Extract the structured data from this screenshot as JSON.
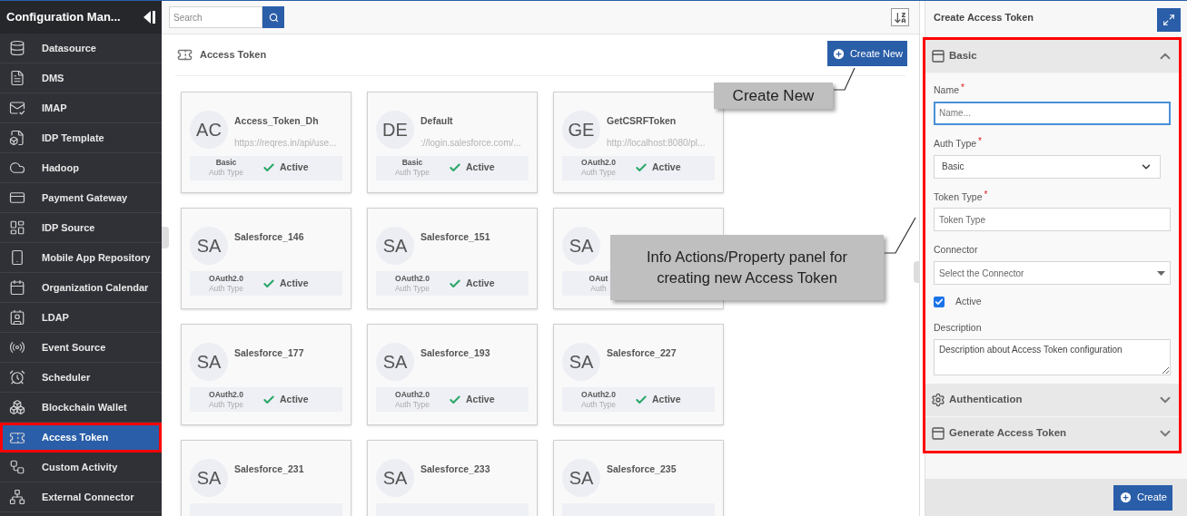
{
  "sidebar": {
    "title": "Configuration Man...",
    "items": [
      {
        "label": "Datasource",
        "selected": false
      },
      {
        "label": "DMS",
        "selected": false
      },
      {
        "label": "IMAP",
        "selected": false
      },
      {
        "label": "IDP Template",
        "selected": false
      },
      {
        "label": "Hadoop",
        "selected": false
      },
      {
        "label": "Payment Gateway",
        "selected": false
      },
      {
        "label": "IDP Source",
        "selected": false
      },
      {
        "label": "Mobile App Repository",
        "selected": false
      },
      {
        "label": "Organization Calendar",
        "selected": false
      },
      {
        "label": "LDAP",
        "selected": false
      },
      {
        "label": "Event Source",
        "selected": false
      },
      {
        "label": "Scheduler",
        "selected": false
      },
      {
        "label": "Blockchain Wallet",
        "selected": false
      },
      {
        "label": "Access Token",
        "selected": true
      },
      {
        "label": "Custom Activity",
        "selected": false
      },
      {
        "label": "External Connector",
        "selected": false
      }
    ]
  },
  "toolbar": {
    "search": {
      "placeholder": "Search"
    }
  },
  "main": {
    "title": "Access Token",
    "create_button": "Create New",
    "cards": [
      {
        "initials": "AC",
        "name": "Access_Token_Dh",
        "url": "https://reqres.in/api/use...",
        "auth_type": "Basic",
        "auth_label": "Auth Type",
        "status": "Active",
        "active": true
      },
      {
        "initials": "DE",
        "name": "Default",
        "url": "://login.salesforce.com/...",
        "auth_type": "Basic",
        "auth_label": "Auth Type",
        "status": "Active",
        "active": true
      },
      {
        "initials": "GE",
        "name": "GetCSRFToken",
        "url": "http://localhost:8080/pl...",
        "auth_type": "OAuth2.0",
        "auth_label": "Auth Type",
        "status": "Active",
        "active": true
      },
      {
        "initials": "SA",
        "name": "Salesforce_146",
        "auth_type": "OAuth2.0",
        "auth_label": "Auth Type",
        "status": "Active",
        "active": true
      },
      {
        "initials": "SA",
        "name": "Salesforce_151",
        "auth_type": "OAuth2.0",
        "auth_label": "Auth Type",
        "status": "Active",
        "active": true
      },
      {
        "initials": "SA",
        "auth_type": "OAut",
        "auth_label": "Auth"
      },
      {
        "initials": "SA",
        "name": "Salesforce_177",
        "auth_type": "OAuth2.0",
        "auth_label": "Auth Type",
        "status": "Active",
        "active": true
      },
      {
        "initials": "SA",
        "name": "Salesforce_193",
        "auth_type": "OAuth2.0",
        "auth_label": "Auth Type",
        "status": "Active",
        "active": true
      },
      {
        "initials": "SA",
        "name": "Salesforce_227",
        "auth_type": "OAuth2.0",
        "auth_label": "Auth Type",
        "status": "Active",
        "active": true
      },
      {
        "initials": "SA",
        "name": "Salesforce_231"
      },
      {
        "initials": "SA",
        "name": "Salesforce_233"
      },
      {
        "initials": "SA",
        "name": "Salesforce_235"
      }
    ]
  },
  "panel": {
    "title": "Create Access Token",
    "sections": [
      {
        "title": "Basic",
        "expanded": true,
        "fields": [
          {
            "kind": "text",
            "label": "Name",
            "required_mark": "*",
            "placeholder": "Name...",
            "focused": true
          },
          {
            "kind": "select",
            "label": "Auth Type",
            "required_mark": "*",
            "value": "Basic"
          },
          {
            "kind": "text",
            "label": "Token Type",
            "required_mark": "*",
            "placeholder": "Token Type",
            "focused": false
          },
          {
            "kind": "combo",
            "label": "Connector",
            "placeholder": "Select the Connector"
          },
          {
            "kind": "checkbox",
            "label": "Active",
            "checked": true
          },
          {
            "kind": "textarea",
            "label": "Description",
            "value": "Description about Access Token configuration"
          }
        ]
      },
      {
        "title": "Authentication",
        "expanded": false
      },
      {
        "title": "Generate Access Token",
        "expanded": false
      }
    ],
    "create_button": "Create"
  },
  "callouts": [
    {
      "text": "Create New"
    },
    {
      "text": "Info Actions/Property panel for creating new Access Token"
    }
  ]
}
